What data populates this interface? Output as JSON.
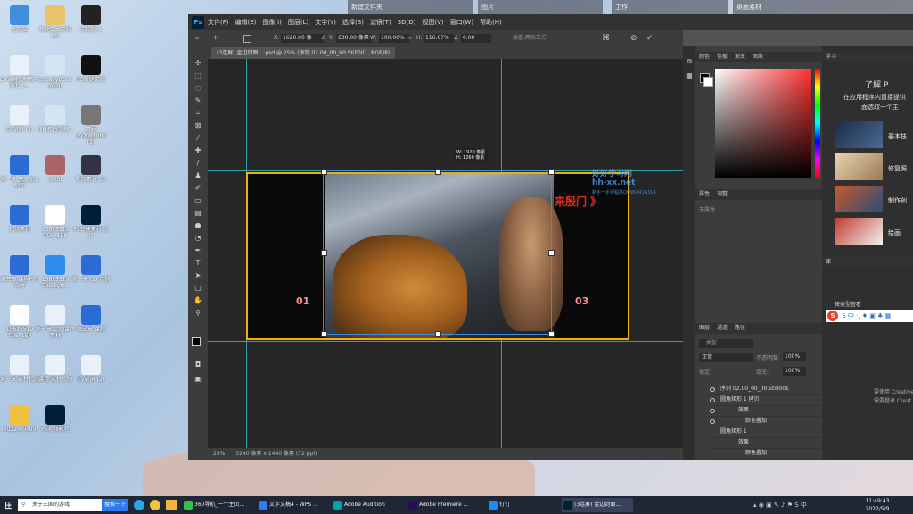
{
  "desktop": {
    "topbar_items": [
      "新建文件夹",
      "图片",
      "工作",
      "桌面素材"
    ],
    "icons": [
      {
        "label": "此电脑",
        "color": "#3e8edc"
      },
      {
        "label": "新建文本文档 (3)",
        "color": "#e9c46a"
      },
      {
        "label": "未标题-1",
        "color": "#222"
      },
      {
        "label": "EV录屏视频教学课程 (...",
        "color": "#e9f0f7"
      },
      {
        "label": "qqdaily0516 2020",
        "color": "#d4e4f3"
      },
      {
        "label": "PS新建文档",
        "color": "#111"
      },
      {
        "label": "EV录屏 (1)",
        "color": "#e9f0f7"
      },
      {
        "label": "抖音教程视频...",
        "color": "#d4e4f3"
      },
      {
        "label": "素材 1920x1080 (3)",
        "color": "#777"
      },
      {
        "label": "第一章 无法加入公司",
        "color": "#2b6cd4"
      },
      {
        "label": "dddd",
        "color": "#a66"
      },
      {
        "label": "视频素材 (2)",
        "color": "#334"
      },
      {
        "label": "视频素材",
        "color": "#2b6cd4"
      },
      {
        "label": "15625519 TUE_15P",
        "color": "#ffffff"
      },
      {
        "label": "PS新建素材 设计",
        "color": "#001e36"
      },
      {
        "label": "第三章 课程PPT 课时",
        "color": "#2b6cd4"
      },
      {
        "label": "15625519 TUE_Lytt...",
        "color": "#2d8cf0"
      },
      {
        "label": "第一章 (2) 示例",
        "color": "#2b6cd4"
      },
      {
        "label": "15625519 TUE_15P",
        "color": "#ffffff"
      },
      {
        "label": "第一章 示例课件素材",
        "color": "#e9f0f7"
      },
      {
        "label": "第三章 课程",
        "color": "#2b6cd4"
      },
      {
        "label": "第一章 素材视频",
        "color": "#e9f0f7"
      },
      {
        "label": "课程 素材视频",
        "color": "#e9f0f7"
      },
      {
        "label": "EV录屏 (2)",
        "color": "#e9f0f7"
      },
      {
        "label": "2022_05_09",
        "color": "#f0c040"
      },
      {
        "label": "PS视频教程",
        "color": "#001e36"
      }
    ]
  },
  "photoshop": {
    "logo": "Ps",
    "menu": [
      "文件(F)",
      "编辑(E)",
      "图像(I)",
      "图层(L)",
      "文字(Y)",
      "选择(S)",
      "滤镜(T)",
      "3D(D)",
      "视图(V)",
      "窗口(W)",
      "帮助(H)"
    ],
    "options": {
      "x_label": "X:",
      "x_value": "1620.00 像",
      "y_label": "Y:",
      "y_value": "630.00 像素",
      "w_label": "W:",
      "w_value": "100.00%",
      "h_label": "H:",
      "h_value": "116.67%",
      "angle_value": "0.00",
      "interp_label": "插值:两次立方"
    },
    "doc_tab": "(3连屏) 金边封面。.psd @ 25% (序列 02.00_00_00.Still001, RGB/8)",
    "canvas": {
      "label_left": "01",
      "label_right": "03",
      "title_text": "来殷门 》",
      "size_tip_w": "W: 1920 像素",
      "size_tip_h": "H: 1260 像素",
      "watermark": "好好学习网",
      "watermark_url": "hh-xx.net",
      "watermark_sub": "新手一手课程站QQ953416314"
    },
    "status": {
      "zoom": "25%",
      "doc_size": "3240 像素 x 1440 像素 (72 ppi)"
    },
    "color_tabs": [
      "颜色",
      "色板",
      "渐变",
      "图案"
    ],
    "props_tabs": [
      "属性",
      "调整"
    ],
    "props_empty": "无属性",
    "layers": {
      "tabs": [
        "图层",
        "通道",
        "路径"
      ],
      "search_placeholder": "类型",
      "blend_mode": "正常",
      "opacity_label": "不透明度:",
      "opacity_value": "100%",
      "lock_label": "锁定:",
      "fill_label": "填充:",
      "fill_value": "100%",
      "rows": [
        {
          "name": "序列 02.00_00_00.Still001",
          "visible": true
        },
        {
          "name": "圆角矩形 1 拷贝",
          "visible": true
        },
        {
          "name": "效果",
          "visible": true
        },
        {
          "name": "颜色叠加",
          "visible": true
        },
        {
          "name": "圆角矩形 1",
          "visible": false
        },
        {
          "name": "效果",
          "visible": false
        },
        {
          "name": "颜色叠加",
          "visible": false
        }
      ]
    },
    "learn": {
      "tab": "学习",
      "heading": "了解 P",
      "text1": "在应用程序内直接提供",
      "text2": "面选取一个主",
      "items": [
        "基本技",
        "修复照",
        "制作创",
        "绘画"
      ],
      "library": "库",
      "filter_label": "按类型查看",
      "footer1": "要使用 Creative",
      "footer2": "需要登录 Creat"
    },
    "colors": {
      "accent": "#31a8ff",
      "frame": "#f4b000",
      "guide": "#2fc3c9"
    }
  },
  "sogou_bar": {
    "label": "S 中 ·, ♦ ▣ ♣ ▦"
  },
  "taskbar": {
    "search_text": "关于三国的游戏",
    "search_button": "搜索一下",
    "apps": [
      {
        "label": "360导航_一个主页...",
        "color": "#3bbf4a"
      },
      {
        "label": "文字文稿4 - WPS ...",
        "color": "#2f7af0"
      },
      {
        "label": "Adobe Audition",
        "color": "#00a3a3"
      },
      {
        "label": "Adobe Premiere ...",
        "color": "#2a0a5e"
      },
      {
        "label": "钉钉",
        "color": "#1a8cff"
      },
      {
        "label": "(3连屏) 金边封面...",
        "color": "#001e36"
      }
    ],
    "time": "11:49:43",
    "date": "2022/5/9"
  }
}
